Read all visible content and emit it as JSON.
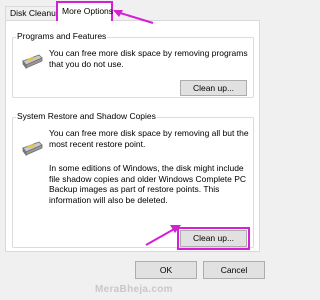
{
  "tabs": [
    {
      "label": "Disk Cleanup"
    },
    {
      "label": "More Options"
    }
  ],
  "programs": {
    "title": "Programs and Features",
    "description": "You can free more disk space by removing programs that you do not use.",
    "button": "Clean up..."
  },
  "restore": {
    "title": "System Restore and Shadow Copies",
    "description": "You can free more disk space by removing all but the most recent restore point.",
    "details": "In some editions of Windows, the disk might include file shadow copies and older Windows Complete PC Backup images as part of restore points. This information will also be deleted.",
    "button": "Clean up..."
  },
  "footer": {
    "ok": "OK",
    "cancel": "Cancel"
  },
  "watermark": "MeraBheja.com",
  "colors": {
    "highlight": "#d41fd3",
    "panel": "#ffffff",
    "background": "#f0f0f0"
  },
  "icons": {
    "programs": "drive-icon",
    "restore": "drive-icon"
  }
}
